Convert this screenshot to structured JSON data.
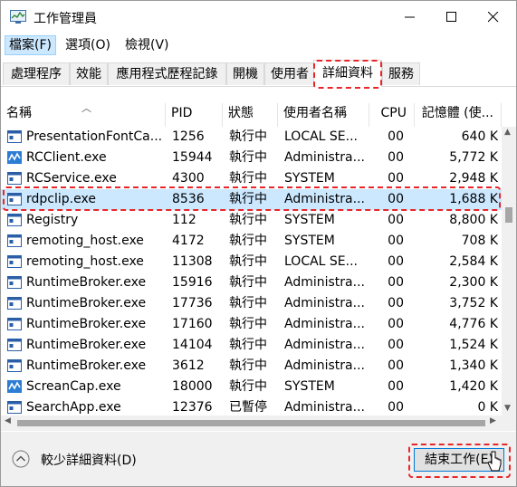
{
  "window": {
    "title": "工作管理員",
    "icon": "task-manager-icon",
    "controls": [
      "minimize-icon",
      "maximize-icon",
      "close-icon"
    ]
  },
  "menu": [
    {
      "label": "檔案(F)"
    },
    {
      "label": "選項(O)"
    },
    {
      "label": "檢視(V)"
    }
  ],
  "tabs": [
    {
      "label": "處理程序"
    },
    {
      "label": "效能"
    },
    {
      "label": "應用程式歷程記錄"
    },
    {
      "label": "開機"
    },
    {
      "label": "使用者"
    },
    {
      "label": "詳細資料",
      "selected": true
    },
    {
      "label": "服務"
    }
  ],
  "table": {
    "columns": [
      "名稱",
      "PID",
      "狀態",
      "使用者名稱",
      "CPU",
      "記憶體 (使..."
    ],
    "rows": [
      {
        "name": "PresentationFontCa...",
        "pid": "1256",
        "status": "執行中",
        "user": "LOCAL SE...",
        "cpu": "00",
        "mem": "640 K",
        "icon": "generic-process-icon"
      },
      {
        "name": "RCClient.exe",
        "pid": "15944",
        "status": "執行中",
        "user": "Administra...",
        "cpu": "00",
        "mem": "5,772 K",
        "icon": "blue-app-icon"
      },
      {
        "name": "RCService.exe",
        "pid": "4300",
        "status": "執行中",
        "user": "SYSTEM",
        "cpu": "00",
        "mem": "2,948 K",
        "icon": "generic-process-icon"
      },
      {
        "name": "rdpclip.exe",
        "pid": "8536",
        "status": "執行中",
        "user": "Administra...",
        "cpu": "00",
        "mem": "1,688 K",
        "icon": "generic-process-icon",
        "selected": true
      },
      {
        "name": "Registry",
        "pid": "112",
        "status": "執行中",
        "user": "SYSTEM",
        "cpu": "00",
        "mem": "8,800 K",
        "icon": "generic-process-icon"
      },
      {
        "name": "remoting_host.exe",
        "pid": "4172",
        "status": "執行中",
        "user": "SYSTEM",
        "cpu": "00",
        "mem": "708 K",
        "icon": "generic-process-icon"
      },
      {
        "name": "remoting_host.exe",
        "pid": "11308",
        "status": "執行中",
        "user": "LOCAL SE...",
        "cpu": "00",
        "mem": "2,584 K",
        "icon": "generic-process-icon"
      },
      {
        "name": "RuntimeBroker.exe",
        "pid": "15916",
        "status": "執行中",
        "user": "Administra...",
        "cpu": "00",
        "mem": "2,300 K",
        "icon": "generic-process-icon"
      },
      {
        "name": "RuntimeBroker.exe",
        "pid": "17736",
        "status": "執行中",
        "user": "Administra...",
        "cpu": "00",
        "mem": "3,752 K",
        "icon": "generic-process-icon"
      },
      {
        "name": "RuntimeBroker.exe",
        "pid": "17160",
        "status": "執行中",
        "user": "Administra...",
        "cpu": "00",
        "mem": "4,776 K",
        "icon": "generic-process-icon"
      },
      {
        "name": "RuntimeBroker.exe",
        "pid": "14104",
        "status": "執行中",
        "user": "Administra...",
        "cpu": "00",
        "mem": "1,524 K",
        "icon": "generic-process-icon"
      },
      {
        "name": "RuntimeBroker.exe",
        "pid": "3612",
        "status": "執行中",
        "user": "Administra...",
        "cpu": "00",
        "mem": "1,340 K",
        "icon": "generic-process-icon"
      },
      {
        "name": "ScreanCap.exe",
        "pid": "18000",
        "status": "執行中",
        "user": "SYSTEM",
        "cpu": "00",
        "mem": "1,420 K",
        "icon": "blue-app-icon"
      },
      {
        "name": "SearchApp.exe",
        "pid": "12376",
        "status": "已暫停",
        "user": "Administra...",
        "cpu": "00",
        "mem": "0 K",
        "icon": "generic-process-icon"
      }
    ]
  },
  "footer": {
    "fewer_details": "較少詳細資料(D)",
    "end_task": "結束工作(E)"
  },
  "colors": {
    "highlight_dash": "#e8262a",
    "selected_row": "#cce8ff",
    "button_border": "#0078d7",
    "app_icon_blue": "#2b7cd3"
  }
}
